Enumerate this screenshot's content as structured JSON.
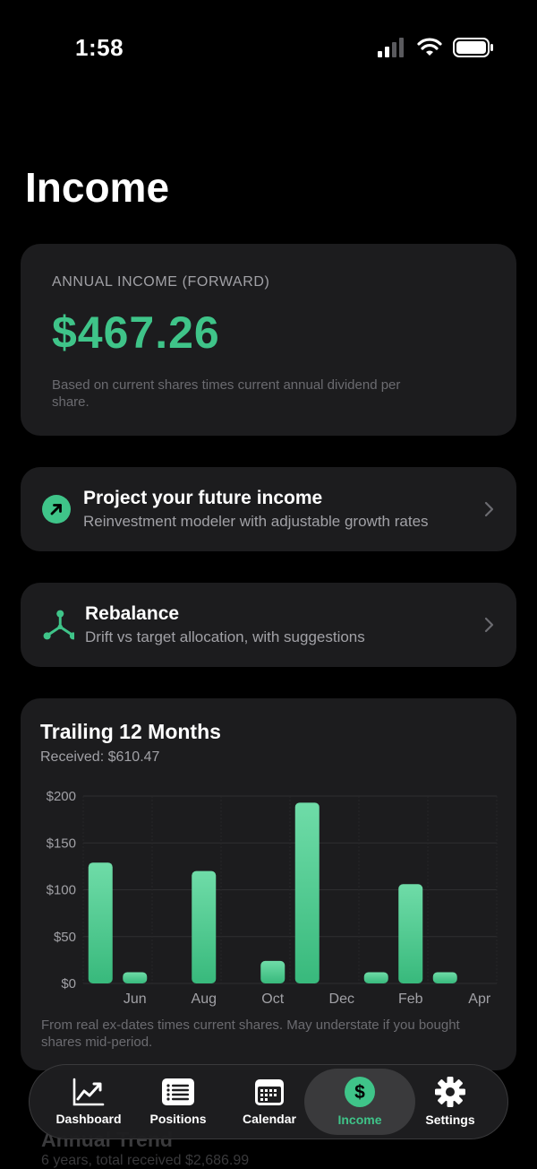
{
  "status": {
    "time": "1:58"
  },
  "page": {
    "title": "Income"
  },
  "annual_income": {
    "label": "ANNUAL INCOME (FORWARD)",
    "value": "$467.26",
    "note": "Based on current shares times current annual dividend per share.",
    "accent": "#3fc489"
  },
  "links": [
    {
      "title": "Project your future income",
      "subtitle": "Reinvestment modeler with adjustable growth rates",
      "icon": "arrow-up-right-circle-icon"
    },
    {
      "title": "Rebalance",
      "subtitle": "Drift vs target allocation, with suggestions",
      "icon": "network-nodes-icon"
    }
  ],
  "trailing": {
    "title": "Trailing 12 Months",
    "received": "Received: $610.47",
    "footnote": "From real ex-dates times current shares. May understate if you bought shares mid-period."
  },
  "chart_data": {
    "type": "bar",
    "categories": [
      "May",
      "Jun",
      "Jul",
      "Aug",
      "Sep",
      "Oct",
      "Nov",
      "Dec",
      "Jan",
      "Feb",
      "Mar",
      "Apr"
    ],
    "x_tick_labels": [
      "Jun",
      "Aug",
      "Oct",
      "Dec",
      "Feb",
      "Apr"
    ],
    "values": [
      129,
      12,
      0,
      120,
      0,
      24,
      193,
      0,
      12,
      106,
      12,
      0
    ],
    "y_ticks": [
      "$0",
      "$50",
      "$100",
      "$150",
      "$200"
    ],
    "ylim": [
      0,
      200
    ],
    "grid": true,
    "color": "#3fc489"
  },
  "ghost_section": {
    "title": "Annual Trend",
    "subtitle": "6 years, total received $2,686.99"
  },
  "tabs": [
    {
      "label": "Dashboard",
      "icon": "chart-line-icon"
    },
    {
      "label": "Positions",
      "icon": "list-icon"
    },
    {
      "label": "Calendar",
      "icon": "calendar-icon"
    },
    {
      "label": "Income",
      "icon": "dollar-circle-icon",
      "active": true
    },
    {
      "label": "Settings",
      "icon": "gear-icon"
    }
  ]
}
